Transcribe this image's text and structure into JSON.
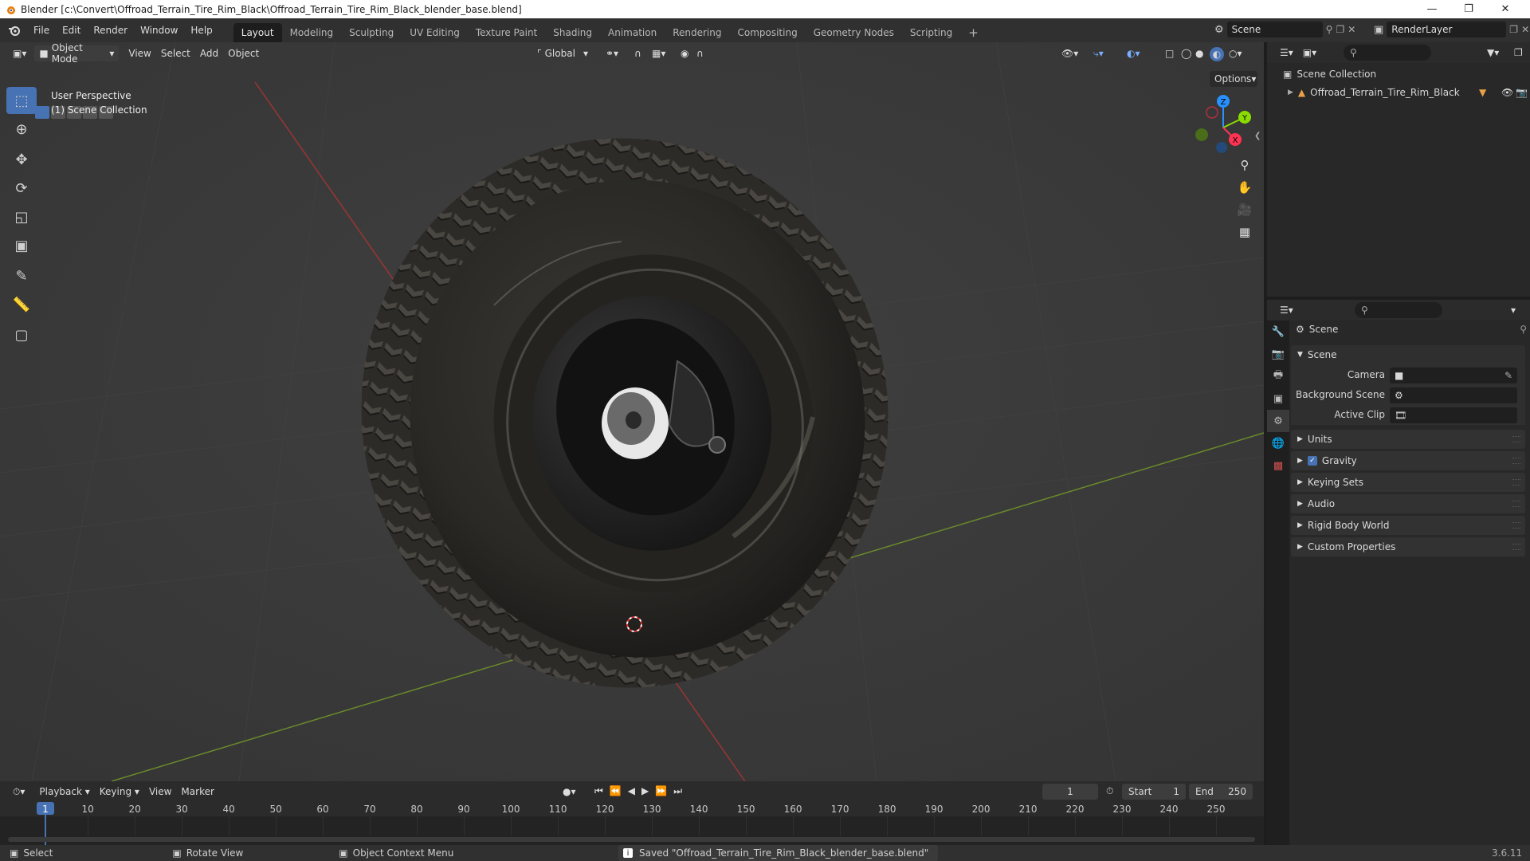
{
  "window": {
    "title": "Blender [c:\\Convert\\Offroad_Terrain_Tire_Rim_Black\\Offroad_Terrain_Tire_Rim_Black_blender_base.blend]"
  },
  "menus": [
    "File",
    "Edit",
    "Render",
    "Window",
    "Help"
  ],
  "workspaces": [
    "Layout",
    "Modeling",
    "Sculpting",
    "UV Editing",
    "Texture Paint",
    "Shading",
    "Animation",
    "Rendering",
    "Compositing",
    "Geometry Nodes",
    "Scripting"
  ],
  "active_workspace": "Layout",
  "scene_name": "Scene",
  "render_layer": "RenderLayer",
  "viewport_header": {
    "mode": "Object Mode",
    "menus": [
      "View",
      "Select",
      "Add",
      "Object"
    ],
    "transform_orientation": "Global",
    "options_label": "Options"
  },
  "viewport": {
    "perspective_label": "User Perspective",
    "collection_label": "(1) Scene Collection",
    "gizmo": {
      "z": "Z",
      "y": "Y",
      "x": "X"
    }
  },
  "outliner": {
    "root": "Scene Collection",
    "items": [
      {
        "label": "Offroad_Terrain_Tire_Rim_Black"
      }
    ]
  },
  "properties": {
    "context_title": "Scene",
    "section_title": "Scene",
    "fields": [
      {
        "label": "Camera"
      },
      {
        "label": "Background Scene"
      },
      {
        "label": "Active Clip"
      }
    ],
    "panels": [
      "Units",
      "Gravity",
      "Keying Sets",
      "Audio",
      "Rigid Body World",
      "Custom Properties"
    ],
    "gravity_checked": true
  },
  "timeline": {
    "menus": [
      "Playback",
      "Keying",
      "View",
      "Marker"
    ],
    "current_frame": "1",
    "start_label": "Start",
    "start": "1",
    "end_label": "End",
    "end": "250",
    "ticks": [
      "1",
      "10",
      "20",
      "30",
      "40",
      "50",
      "60",
      "70",
      "80",
      "90",
      "100",
      "110",
      "120",
      "130",
      "140",
      "150",
      "160",
      "170",
      "180",
      "190",
      "200",
      "210",
      "220",
      "230",
      "240",
      "250"
    ]
  },
  "statusbar": {
    "select": "Select",
    "rotate": "Rotate View",
    "context_menu": "Object Context Menu",
    "message": "Saved \"Offroad_Terrain_Tire_Rim_Black_blender_base.blend\"",
    "version": "3.6.11"
  },
  "colors": {
    "accent": "#4772b3",
    "x_axis": "#ff3352",
    "y_axis": "#8bdc00",
    "z_axis": "#2890ff",
    "frame_marker": "#4772b3"
  }
}
